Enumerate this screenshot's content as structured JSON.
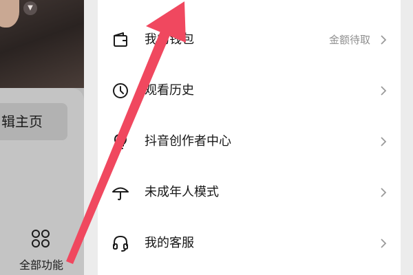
{
  "left_panel": {
    "edit_home_label": "辑主页",
    "all_functions_label": "全部功能"
  },
  "menu": {
    "items": [
      {
        "label": "我的钱包",
        "hint": "金额待取",
        "icon": "wallet-icon"
      },
      {
        "label": "观看历史",
        "hint": "",
        "icon": "clock-icon"
      },
      {
        "label": "抖音创作者中心",
        "hint": "",
        "icon": "lightbulb-icon"
      },
      {
        "label": "未成年人模式",
        "hint": "",
        "icon": "umbrella-icon"
      },
      {
        "label": "我的客服",
        "hint": "",
        "icon": "headset-icon"
      }
    ]
  },
  "annotation": {
    "arrow_color": "#f0485f"
  }
}
